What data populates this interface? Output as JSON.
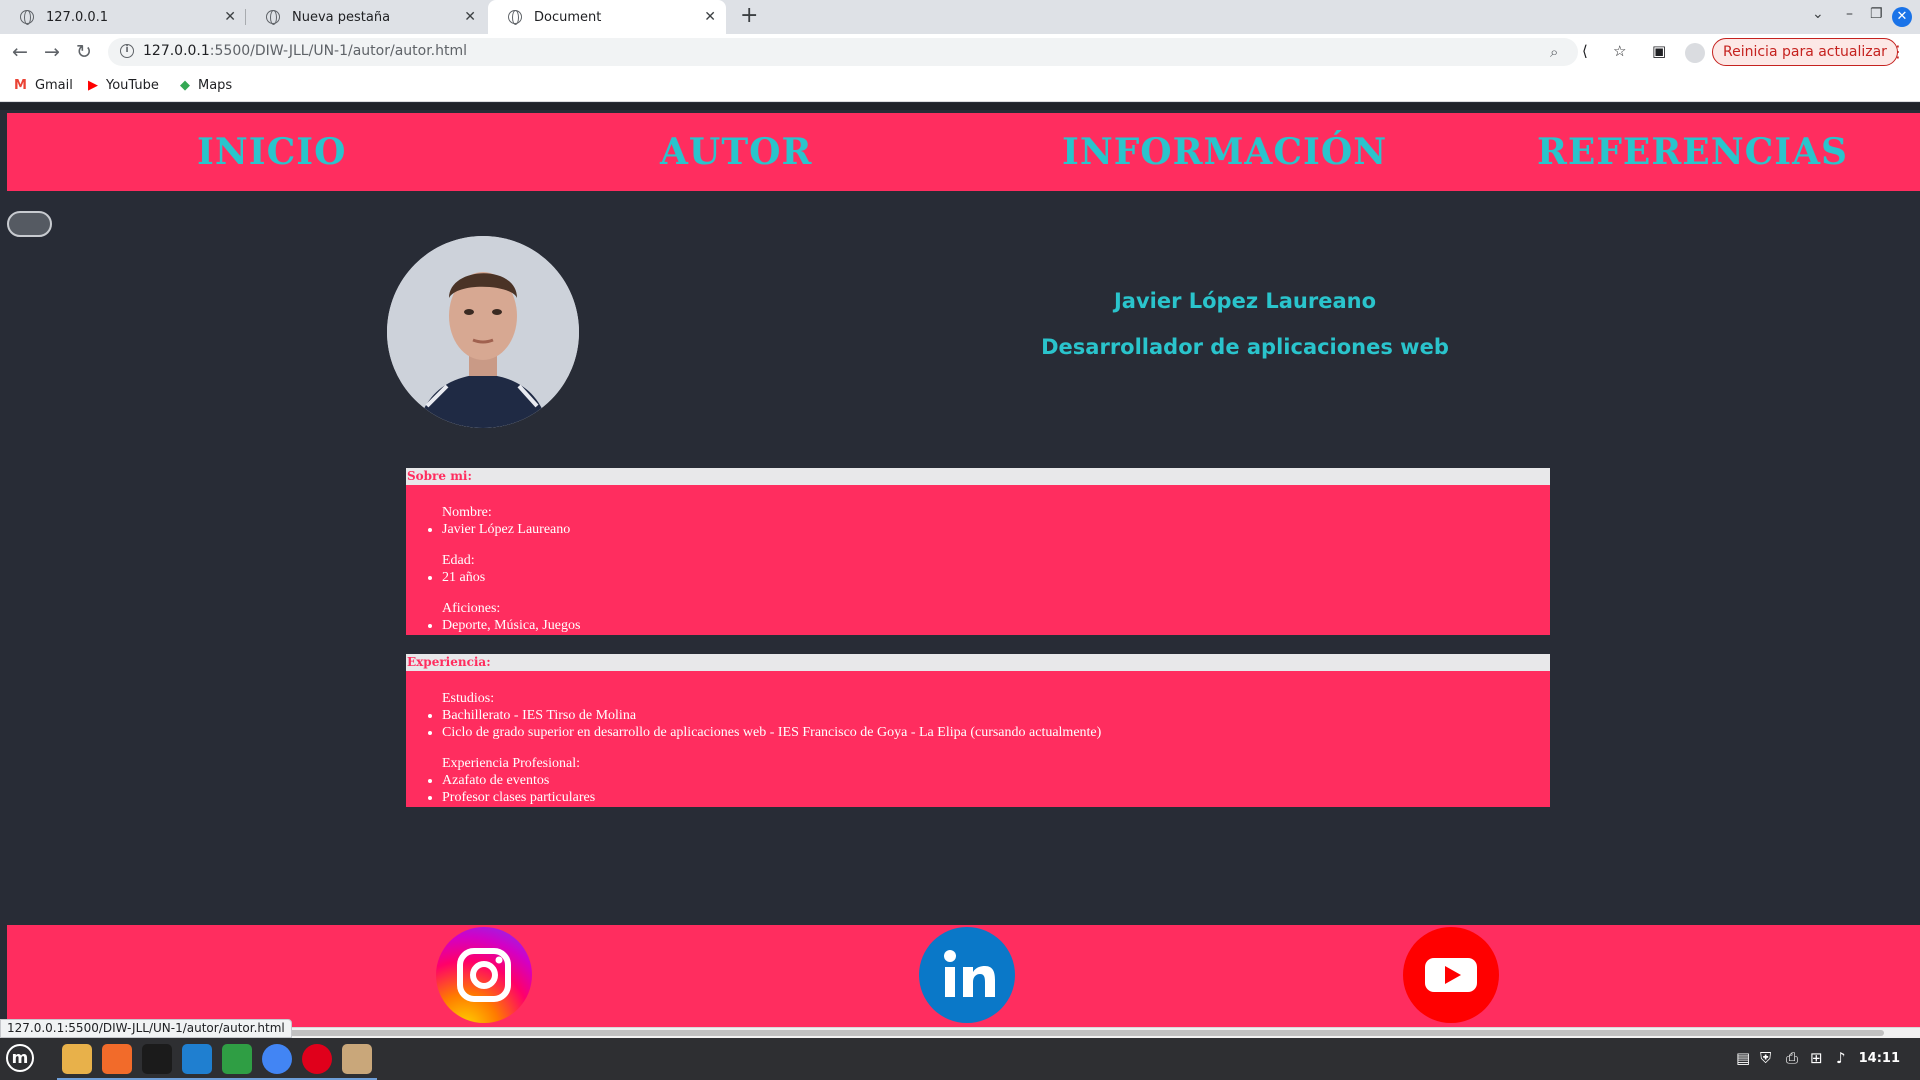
{
  "browser": {
    "tabs": [
      {
        "title": "127.0.0.1"
      },
      {
        "title": "Nueva pestaña"
      },
      {
        "title": "Document"
      }
    ],
    "url_host": "127.0.0.1",
    "url_path": ":5500/DIW-JLL/UN-1/autor/autor.html",
    "update_button": "Reinicia para actualizar",
    "bookmarks": [
      {
        "label": "Gmail"
      },
      {
        "label": "YouTube"
      },
      {
        "label": "Maps"
      }
    ],
    "status_url": "127.0.0.1:5500/DIW-JLL/UN-1/autor/autor.html"
  },
  "nav": {
    "items": [
      {
        "label": "INICIO"
      },
      {
        "label": "AUTOR"
      },
      {
        "label": "INFORMACIÓN"
      },
      {
        "label": "REFERENCIAS"
      }
    ]
  },
  "profile": {
    "name": "Javier López Laureano",
    "role": "Desarrollador de aplicaciones web"
  },
  "about": {
    "title": "Sobre mi:",
    "groups": [
      {
        "label": "Nombre:",
        "items": [
          "Javier López Laureano"
        ]
      },
      {
        "label": "Edad:",
        "items": [
          "21 años"
        ]
      },
      {
        "label": "Aficiones:",
        "items": [
          "Deporte, Música, Juegos"
        ]
      }
    ]
  },
  "experience": {
    "title": "Experiencia:",
    "groups": [
      {
        "label": "Estudios:",
        "items": [
          "Bachillerato - IES Tirso de Molina",
          "Ciclo de grado superior en desarrollo de aplicaciones web - IES Francisco de Goya - La Elipa (cursando actualmente)"
        ]
      },
      {
        "label": "Experiencia Profesional:",
        "items": [
          "Azafato de eventos",
          "Profesor clases particulares"
        ]
      }
    ]
  },
  "social": [
    "instagram-icon",
    "linkedin-icon",
    "youtube-icon"
  ],
  "taskbar": {
    "clock": "14:11"
  },
  "colors": {
    "accent": "#ff2d5f",
    "link": "#2ac4cc",
    "background": "#282c36"
  }
}
